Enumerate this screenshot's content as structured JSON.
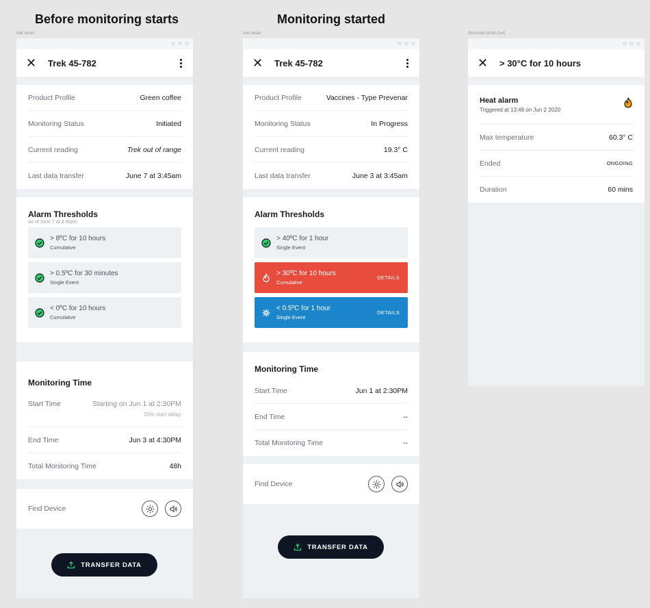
{
  "board": {
    "title_left": "Before monitoring starts",
    "title_mid": "Monitoring started",
    "label_left": "trek detail",
    "label_mid": "trek detail",
    "label_right": "threshold detail (hot)"
  },
  "colors": {
    "accent_dark": "#0f1623",
    "alarm_red": "#e74c3c",
    "alarm_blue": "#1b86cc",
    "ok_green": "#2ecc71"
  },
  "screen1": {
    "title": "Trek 45-782",
    "info": [
      {
        "label": "Product Profile",
        "value": "Green coffee"
      },
      {
        "label": "Monitoring Status",
        "value": "Initiated"
      },
      {
        "label": "Current reading",
        "value": "Trek out of range"
      },
      {
        "label": "Last data transfer",
        "value": "June 7 at 3:45am"
      }
    ],
    "alarms_title": "Alarm Thresholds",
    "alarms_sub": "As of June 7 at 3:45pm",
    "alarms": [
      {
        "main": "> 8ºC for 10 hours",
        "sub": "Cumulative",
        "icon": "check-circle-icon"
      },
      {
        "main": "> 0.5ºC for 30 minutes",
        "sub": "Single Event",
        "icon": "check-circle-icon"
      },
      {
        "main": "< 0ºC for 10 hours",
        "sub": "Cumulative",
        "icon": "check-circle-icon"
      }
    ],
    "time_title": "Monitoring Time",
    "start_label": "Start Time",
    "start_value": "Starting on Jun 1 at 2:30PM",
    "start_note": "20m start delay",
    "end_label": "End Time",
    "end_value": "Jun 3 at 4:30PM",
    "total_label": "Total Monitoring Time",
    "total_value": "48h",
    "find_label": "Find Device",
    "transfer_label": "TRANSFER DATA"
  },
  "screen2": {
    "title": "Trek 45-782",
    "info": [
      {
        "label": "Product Profile",
        "value": "Vaccines - Type Prevenar"
      },
      {
        "label": "Monitoring Status",
        "value": "In Progress"
      },
      {
        "label": "Current reading",
        "value": "19.3° C"
      },
      {
        "label": "Last data transfer",
        "value": "June 3 at 3:45am"
      }
    ],
    "alarms_title": "Alarm Thresholds",
    "alarms": [
      {
        "main": "> 40ºC for 1 hour",
        "sub": "Single Event",
        "icon": "check-circle-icon"
      },
      {
        "main": "> 30ºC for 10 hours",
        "sub": "Cumulative",
        "icon": "flame-icon",
        "action": "DETAILS"
      },
      {
        "main": "< 0.5ºC for 1 hour",
        "sub": "Single Event",
        "icon": "snowflake-icon",
        "action": "DETAILS"
      }
    ],
    "time_title": "Monitoring Time",
    "start_label": "Start Time",
    "start_value": "Jun 1 at 2:30PM",
    "end_label": "End Time",
    "end_value": "--",
    "total_label": "Total Monitoring Time",
    "total_value": "--",
    "find_label": "Find Device",
    "transfer_label": "TRANSFER DATA"
  },
  "screen3": {
    "title": "> 30°C for 10 hours",
    "alarm_title": "Heat alarm",
    "alarm_sub": "Triggered at 13:49 on Jun 2 2020",
    "rows": [
      {
        "label": "Max temperature",
        "value": "60.3° C"
      },
      {
        "label": "Ended",
        "value": "ONGOING"
      },
      {
        "label": "Duration",
        "value": "60 mins"
      }
    ]
  }
}
